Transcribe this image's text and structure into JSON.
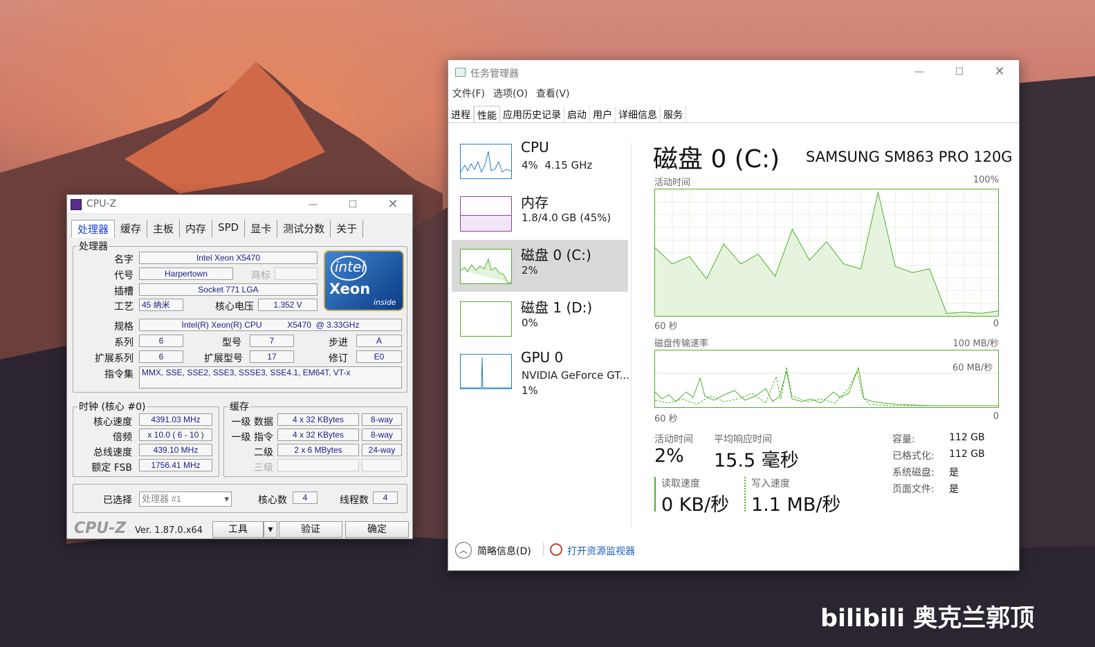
{
  "cpuz": {
    "title": "CPU-Z",
    "tabs": [
      "处理器",
      "缓存",
      "主板",
      "内存",
      "SPD",
      "显卡",
      "测试分数",
      "关于"
    ],
    "proc_legend": "处理器",
    "labels": {
      "name": "名字",
      "code": "代号",
      "socket": "插槽",
      "tech": "工艺",
      "voltage": "核心电压",
      "spec": "规格",
      "family": "系列",
      "model": "型号",
      "stepping": "步进",
      "ext_family": "扩展系列",
      "ext_model": "扩展型号",
      "revision": "修订",
      "instr": "指令集",
      "brand": "商标"
    },
    "values": {
      "name": "Intel Xeon X5470",
      "code": "Harpertown",
      "socket": "Socket 771 LGA",
      "tech": "45 纳米",
      "voltage": "1.352 V",
      "spec": "Intel(R) Xeon(R) CPU           X5470  @ 3.33GHz",
      "family": "6",
      "model": "7",
      "stepping": "A",
      "ext_family": "6",
      "ext_model": "17",
      "revision": "E0",
      "instr": "MMX, SSE, SSE2, SSE3, SSSE3, SSE4.1, EM64T, VT-x"
    },
    "logo": {
      "top": "intel",
      "main": "Xeon",
      "sub": "inside"
    },
    "clock_legend": "时钟 (核心 #0)",
    "clock": [
      {
        "l": "核心速度",
        "v": "4391.03 MHz"
      },
      {
        "l": "倍频",
        "v": "x 10.0 ( 6 - 10 )"
      },
      {
        "l": "总线速度",
        "v": "439.10 MHz"
      },
      {
        "l": "额定 FSB",
        "v": "1756.41 MHz"
      }
    ],
    "cache_legend": "缓存",
    "cache": [
      {
        "l": "一级 数据",
        "v": "4 x 32 KBytes",
        "w": "8-way"
      },
      {
        "l": "一级 指令",
        "v": "4 x 32 KBytes",
        "w": "8-way"
      },
      {
        "l": "二级",
        "v": "2 x 6 MBytes",
        "w": "24-way"
      },
      {
        "l": "三级",
        "v": "",
        "w": ""
      }
    ],
    "selected_label": "已选择",
    "selected": "处理器 #1",
    "cores_label": "核心数",
    "cores": "4",
    "threads_label": "线程数",
    "threads": "4",
    "brand_text": "CPU-Z",
    "version": "Ver. 1.87.0.x64",
    "tools": "工具",
    "validate": "验证",
    "ok": "确定"
  },
  "tm": {
    "title": "任务管理器",
    "menu": [
      "文件(F)",
      "选项(O)",
      "查看(V)"
    ],
    "tabs": [
      "进程",
      "性能",
      "应用历史记录",
      "启动",
      "用户",
      "详细信息",
      "服务"
    ],
    "side": [
      {
        "name": "CPU",
        "sub": "4%  4.15 GHz",
        "color": "#1e7ec8"
      },
      {
        "name": "内存",
        "sub": "1.8/4.0 GB (45%)",
        "color": "#8b3ea8"
      },
      {
        "name": "磁盘 0 (C:)",
        "sub": "2%",
        "color": "#4caf2a"
      },
      {
        "name": "磁盘 1 (D:)",
        "sub": "0%",
        "color": "#4caf2a"
      },
      {
        "name": "GPU 0",
        "sub": "NVIDIA GeForce GT...\n1%",
        "color": "#1e7ec8"
      }
    ],
    "disk_title": "磁盘 0 (C:)",
    "disk_model": "SAMSUNG SM863 PRO 120G",
    "g1": {
      "label": "活动时间",
      "max": "100%",
      "left": "60 秒",
      "right": "0"
    },
    "g2": {
      "label": "磁盘传输速率",
      "max": "100 MB/秒",
      "inner": "60 MB/秒",
      "left": "60 秒",
      "right": "0"
    },
    "stats": {
      "active_l": "活动时间",
      "active_v": "2%",
      "resp_l": "平均响应时间",
      "resp_v": "15.5 毫秒",
      "read_l": "读取速度",
      "read_v": "0 KB/秒",
      "write_l": "写入速度",
      "write_v": "1.1 MB/秒"
    },
    "props": [
      {
        "k": "容量:",
        "v": "112 GB"
      },
      {
        "k": "已格式化:",
        "v": "112 GB"
      },
      {
        "k": "系统磁盘:",
        "v": "是"
      },
      {
        "k": "页面文件:",
        "v": "是"
      }
    ],
    "footer": {
      "brief": "简略信息(D)",
      "monitor": "打开资源监视器"
    }
  },
  "watermark": "bilibili 奥克兰郭顶",
  "chart_data": {
    "type": "area",
    "title": "活动时间",
    "x": [
      60,
      57,
      54,
      51,
      48,
      45,
      42,
      39,
      36,
      33,
      30,
      27,
      24,
      21,
      18,
      15,
      12,
      9,
      6,
      3,
      0
    ],
    "values": [
      55,
      42,
      48,
      30,
      58,
      42,
      50,
      32,
      70,
      45,
      60,
      42,
      38,
      100,
      40,
      35,
      38,
      2,
      3,
      2,
      4
    ],
    "ylim": [
      0,
      100
    ]
  }
}
